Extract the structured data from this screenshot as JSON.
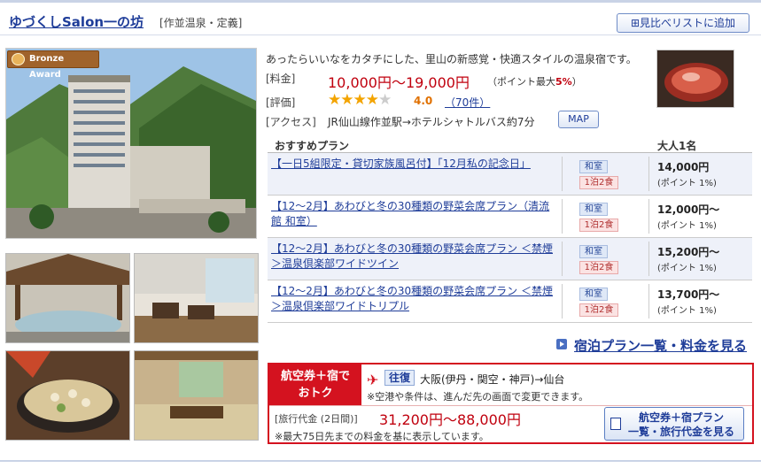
{
  "header": {
    "hotel_name": "ゆづくしSalon一の坊",
    "area": "[作並温泉・定義]",
    "add_compare_label": "見比べリストに追加"
  },
  "award": {
    "label": "Bronze Award"
  },
  "info": {
    "description": "あったらいいなをカタチにした、里山の新感覚・快適スタイルの温泉宿です。",
    "price_label": "[料金]",
    "price": "10,000円〜19,000円",
    "point_note_prefix": "（ポイント最大",
    "point_rate": "5%",
    "point_note_suffix": "）",
    "rating_label": "[評価]",
    "rating_value": "4.0",
    "rating_stars": 4,
    "review_count": "70件",
    "access_label": "[アクセス]",
    "access_text": "JR仙山線作並駅→ホテルシャトルバス約7分",
    "map_label": "MAP"
  },
  "plans": {
    "header_plan": "おすすめプラン",
    "header_price": "大人1名",
    "rows": [
      {
        "name": "【一日5組限定・貸切家族風呂付】「12月私の記念日」",
        "room": "和室",
        "meal": "1泊2食",
        "price": "14,000円",
        "point": "(ポイント 1%)"
      },
      {
        "name": "【12〜2月】あわびと冬の30種類の野菜会席プラン（清流館 和室）",
        "room": "和室",
        "meal": "1泊2食",
        "price": "12,000円〜",
        "point": "(ポイント 1%)"
      },
      {
        "name": "【12〜2月】あわびと冬の30種類の野菜会席プラン ＜禁煙＞温泉倶楽部ワイドツイン",
        "room": "和室",
        "meal": "1泊2食",
        "price": "15,200円〜",
        "point": "(ポイント 1%)"
      },
      {
        "name": "【12〜2月】あわびと冬の30種類の野菜会席プラン ＜禁煙＞温泉倶楽部ワイドトリプル",
        "room": "和室",
        "meal": "1泊2食",
        "price": "13,700円〜",
        "point": "(ポイント 1%)"
      }
    ],
    "all_plans_link": "宿泊プラン一覧・料金を見る"
  },
  "air": {
    "badge_line1": "航空券＋宿で",
    "badge_line2": "おトク",
    "roundtrip": "往復",
    "route": "大阪(伊丹・関空・神戸)→仙台",
    "note1": "※空港や条件は、進んだ先の画面で変更できます。",
    "trip_label": "[旅行代金 (2日間)]",
    "trip_price": "31,200円〜88,000円",
    "note2": "※最大75日先までの料金を基に表示しています。",
    "button_line1": "航空券＋宿プラン",
    "button_line2": "一覧・旅行代金を見る"
  }
}
